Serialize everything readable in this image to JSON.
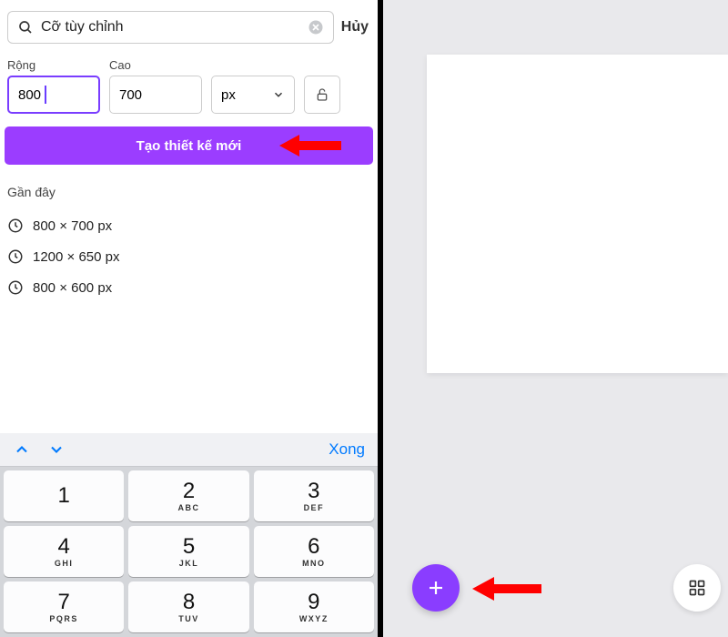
{
  "search": {
    "value": "Cỡ tùy chỉnh",
    "cancel": "Hủy"
  },
  "dimensions": {
    "width_label": "Rộng",
    "height_label": "Cao",
    "width_value": "800",
    "height_value": "700",
    "unit": "px"
  },
  "create_button": "Tạo thiết kế mới",
  "recent": {
    "title": "Gần đây",
    "items": [
      "800 × 700 px",
      "1200 × 650 px",
      "800 × 600 px"
    ]
  },
  "keyboard": {
    "done": "Xong",
    "keys": [
      [
        {
          "n": "1",
          "s": ""
        },
        {
          "n": "2",
          "s": "ABC"
        },
        {
          "n": "3",
          "s": "DEF"
        }
      ],
      [
        {
          "n": "4",
          "s": "GHI"
        },
        {
          "n": "5",
          "s": "JKL"
        },
        {
          "n": "6",
          "s": "MNO"
        }
      ],
      [
        {
          "n": "7",
          "s": "PQRS"
        },
        {
          "n": "8",
          "s": "TUV"
        },
        {
          "n": "9",
          "s": "WXYZ"
        }
      ]
    ]
  },
  "colors": {
    "purple": "#9b3dff",
    "fab_purple": "#8a3dff",
    "red": "#ff0000",
    "blue": "#007aff"
  }
}
